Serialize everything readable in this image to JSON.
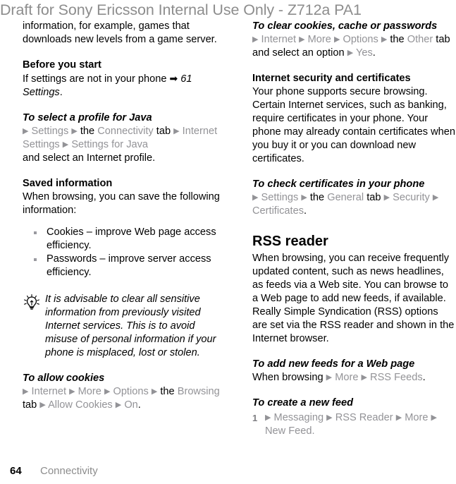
{
  "watermark": {
    "text": "Draft for Sony Ericsson Internal Use Only - Z712a PA1"
  },
  "colors": {
    "watermark_gray": "#8d8d8d",
    "link_gray": "#939397",
    "body_black": "#000000",
    "background": "#ffffff"
  },
  "left_column": {
    "continued_paragraph": "information, for example, games that downloads new levels from a game server.",
    "before_you_start": {
      "heading": "Before you start",
      "text_part1": "If settings are not in your phone ",
      "arrow_glyph": "➡",
      "ref_page": "61",
      "ref_title": "Settings",
      "period": "."
    },
    "select_profile_java": {
      "heading": "To select a profile for Java",
      "path": [
        {
          "type": "tri"
        },
        {
          "type": "link",
          "text": "Settings"
        },
        {
          "type": "tri"
        },
        {
          "type": "black",
          "text": "the"
        },
        {
          "type": "link",
          "text": "Connectivity"
        },
        {
          "type": "black",
          "text": "tab"
        },
        {
          "type": "tri"
        },
        {
          "type": "link",
          "text": "Internet Settings"
        },
        {
          "type": "tri"
        },
        {
          "type": "link",
          "text": "Settings for Java"
        }
      ],
      "trailing_text": "and select an Internet profile."
    },
    "saved_information": {
      "heading": "Saved information",
      "intro": "When browsing, you can save the following information:",
      "bullets": [
        "Cookies – improve Web page access efficiency.",
        "Passwords – improve server access efficiency."
      ]
    },
    "tip": {
      "icon": "lightbulb-tip-icon",
      "text": "It is advisable to clear all sensitive infor­mation from previously visited Internet services. This is to avoid misuse of per­sonal information if your phone is mis­placed, lost or stolen."
    },
    "allow_cookies": {
      "heading": "To allow cookies",
      "path": [
        {
          "type": "tri"
        },
        {
          "type": "link",
          "text": "Internet"
        },
        {
          "type": "tri"
        },
        {
          "type": "link",
          "text": "More"
        },
        {
          "type": "tri"
        },
        {
          "type": "link",
          "text": "Options"
        },
        {
          "type": "tri"
        },
        {
          "type": "black",
          "text": "the"
        },
        {
          "type": "link",
          "text": "Browsing"
        },
        {
          "type": "black",
          "text": "tab"
        },
        {
          "type": "tri"
        },
        {
          "type": "link",
          "text": "Allow Cookies"
        },
        {
          "type": "tri"
        },
        {
          "type": "link",
          "text": "On"
        },
        {
          "type": "black",
          "text": "."
        }
      ]
    }
  },
  "right_column": {
    "clear_cookies": {
      "heading": "To clear cookies, cache or passwords",
      "path": [
        {
          "type": "tri"
        },
        {
          "type": "link",
          "text": "Internet"
        },
        {
          "type": "tri"
        },
        {
          "type": "link",
          "text": "More"
        },
        {
          "type": "tri"
        },
        {
          "type": "link",
          "text": "Options"
        },
        {
          "type": "tri"
        },
        {
          "type": "black",
          "text": "the"
        },
        {
          "type": "link",
          "text": "Other"
        },
        {
          "type": "black",
          "text": "tab and select an option"
        },
        {
          "type": "tri"
        },
        {
          "type": "link",
          "text": "Yes"
        },
        {
          "type": "black",
          "text": "."
        }
      ]
    },
    "internet_security": {
      "heading": "Internet security and certificates",
      "text": "Your phone supports secure browsing. Certain Internet services, such as banking, require certificates in your phone. Your phone may already contain certificates when you buy it or you can download new certificates."
    },
    "check_certificates": {
      "heading": "To check certificates in your phone",
      "path": [
        {
          "type": "tri"
        },
        {
          "type": "link",
          "text": "Settings"
        },
        {
          "type": "tri"
        },
        {
          "type": "black",
          "text": "the"
        },
        {
          "type": "link",
          "text": "General"
        },
        {
          "type": "black",
          "text": "tab"
        },
        {
          "type": "tri"
        },
        {
          "type": "link",
          "text": "Security"
        },
        {
          "type": "tri"
        },
        {
          "type": "link",
          "text": "Certificates"
        },
        {
          "type": "black",
          "text": "."
        }
      ]
    },
    "rss_reader": {
      "heading": "RSS reader",
      "text": "When browsing, you can receive frequently updated content, such as news headlines, as feeds via a Web site. You can browse to a Web page to add new feeds, if available. Really Simple Syndication (RSS) options are set via the RSS reader and shown in the Internet browser."
    },
    "add_new_feeds": {
      "heading": "To add new feeds for a Web page",
      "path": [
        {
          "type": "black",
          "text": "When browsing"
        },
        {
          "type": "tri"
        },
        {
          "type": "link",
          "text": "More"
        },
        {
          "type": "tri"
        },
        {
          "type": "link",
          "text": "RSS Feeds"
        },
        {
          "type": "black",
          "text": "."
        }
      ]
    },
    "create_new_feed": {
      "heading": "To create a new feed",
      "steps": [
        {
          "number": "1",
          "path": [
            {
              "type": "tri"
            },
            {
              "type": "link",
              "text": "Messaging"
            },
            {
              "type": "tri"
            },
            {
              "type": "link",
              "text": "RSS Reader"
            },
            {
              "type": "tri"
            },
            {
              "type": "link",
              "text": "More"
            },
            {
              "type": "tri"
            },
            {
              "type": "link",
              "text": "New Feed."
            }
          ]
        }
      ]
    }
  },
  "footer": {
    "page_number": "64",
    "running_head": "Connectivity"
  }
}
